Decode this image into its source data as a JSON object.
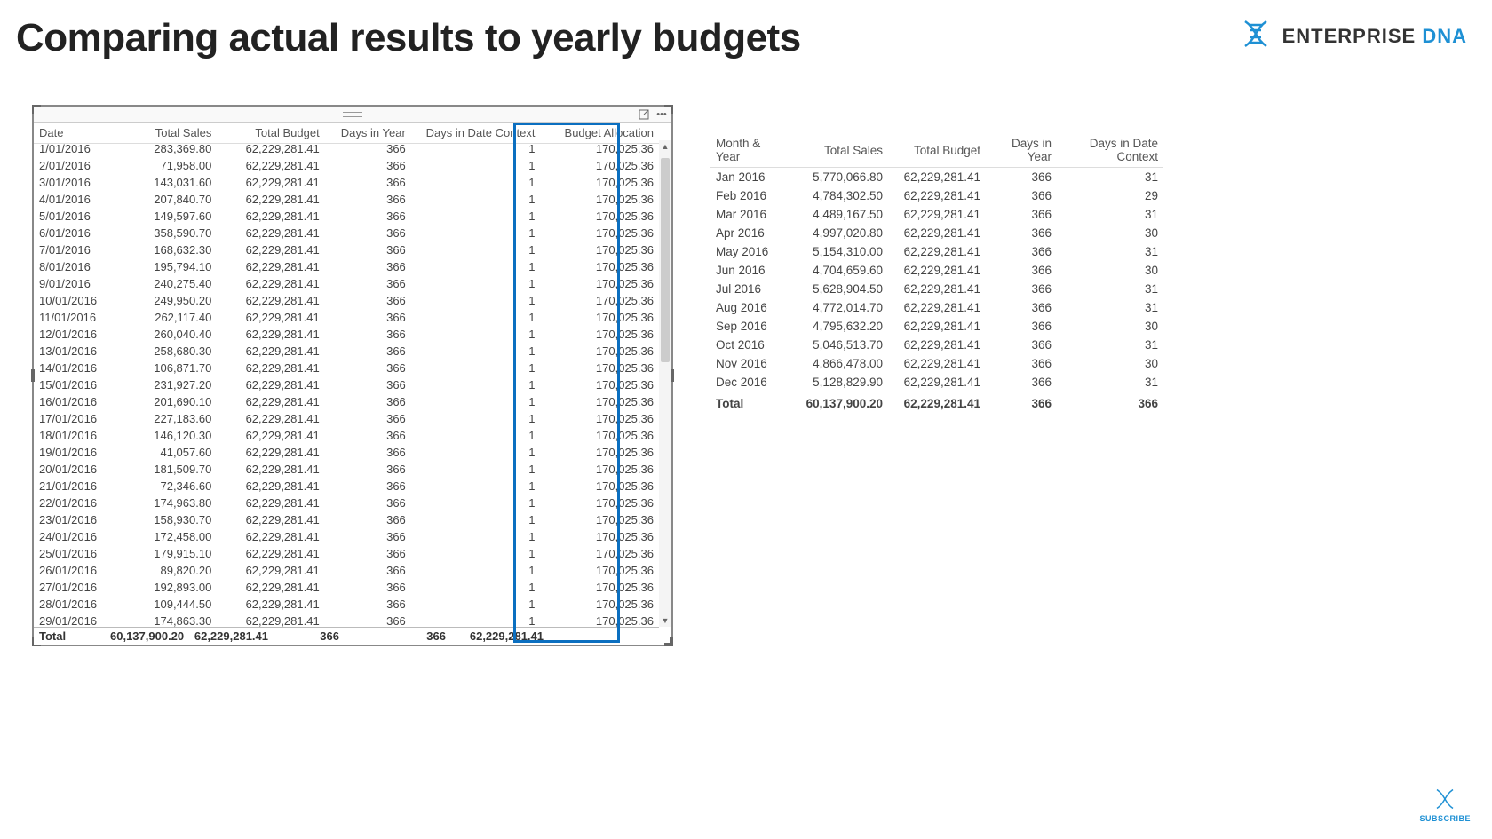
{
  "page_title": "Comparing actual results to yearly budgets",
  "brand": {
    "text1": "ENTERPRISE ",
    "text2": "DNA"
  },
  "subscribe_label": "SUBSCRIBE",
  "daily_table": {
    "headers": {
      "date": "Date",
      "total_sales": "Total Sales",
      "total_budget": "Total Budget",
      "days_in_year": "Days in Year",
      "days_in_context": "Days in Date Context",
      "budget_allocation": "Budget Allocation"
    },
    "rows": [
      {
        "date": "1/01/2016",
        "sales": "283,369.80",
        "budget": "62,229,281.41",
        "diy": "366",
        "ctx": "1",
        "alloc": "170,025.36"
      },
      {
        "date": "2/01/2016",
        "sales": "71,958.00",
        "budget": "62,229,281.41",
        "diy": "366",
        "ctx": "1",
        "alloc": "170,025.36"
      },
      {
        "date": "3/01/2016",
        "sales": "143,031.60",
        "budget": "62,229,281.41",
        "diy": "366",
        "ctx": "1",
        "alloc": "170,025.36"
      },
      {
        "date": "4/01/2016",
        "sales": "207,840.70",
        "budget": "62,229,281.41",
        "diy": "366",
        "ctx": "1",
        "alloc": "170,025.36"
      },
      {
        "date": "5/01/2016",
        "sales": "149,597.60",
        "budget": "62,229,281.41",
        "diy": "366",
        "ctx": "1",
        "alloc": "170,025.36"
      },
      {
        "date": "6/01/2016",
        "sales": "358,590.70",
        "budget": "62,229,281.41",
        "diy": "366",
        "ctx": "1",
        "alloc": "170,025.36"
      },
      {
        "date": "7/01/2016",
        "sales": "168,632.30",
        "budget": "62,229,281.41",
        "diy": "366",
        "ctx": "1",
        "alloc": "170,025.36"
      },
      {
        "date": "8/01/2016",
        "sales": "195,794.10",
        "budget": "62,229,281.41",
        "diy": "366",
        "ctx": "1",
        "alloc": "170,025.36"
      },
      {
        "date": "9/01/2016",
        "sales": "240,275.40",
        "budget": "62,229,281.41",
        "diy": "366",
        "ctx": "1",
        "alloc": "170,025.36"
      },
      {
        "date": "10/01/2016",
        "sales": "249,950.20",
        "budget": "62,229,281.41",
        "diy": "366",
        "ctx": "1",
        "alloc": "170,025.36"
      },
      {
        "date": "11/01/2016",
        "sales": "262,117.40",
        "budget": "62,229,281.41",
        "diy": "366",
        "ctx": "1",
        "alloc": "170,025.36"
      },
      {
        "date": "12/01/2016",
        "sales": "260,040.40",
        "budget": "62,229,281.41",
        "diy": "366",
        "ctx": "1",
        "alloc": "170,025.36"
      },
      {
        "date": "13/01/2016",
        "sales": "258,680.30",
        "budget": "62,229,281.41",
        "diy": "366",
        "ctx": "1",
        "alloc": "170,025.36"
      },
      {
        "date": "14/01/2016",
        "sales": "106,871.70",
        "budget": "62,229,281.41",
        "diy": "366",
        "ctx": "1",
        "alloc": "170,025.36"
      },
      {
        "date": "15/01/2016",
        "sales": "231,927.20",
        "budget": "62,229,281.41",
        "diy": "366",
        "ctx": "1",
        "alloc": "170,025.36"
      },
      {
        "date": "16/01/2016",
        "sales": "201,690.10",
        "budget": "62,229,281.41",
        "diy": "366",
        "ctx": "1",
        "alloc": "170,025.36"
      },
      {
        "date": "17/01/2016",
        "sales": "227,183.60",
        "budget": "62,229,281.41",
        "diy": "366",
        "ctx": "1",
        "alloc": "170,025.36"
      },
      {
        "date": "18/01/2016",
        "sales": "146,120.30",
        "budget": "62,229,281.41",
        "diy": "366",
        "ctx": "1",
        "alloc": "170,025.36"
      },
      {
        "date": "19/01/2016",
        "sales": "41,057.60",
        "budget": "62,229,281.41",
        "diy": "366",
        "ctx": "1",
        "alloc": "170,025.36"
      },
      {
        "date": "20/01/2016",
        "sales": "181,509.70",
        "budget": "62,229,281.41",
        "diy": "366",
        "ctx": "1",
        "alloc": "170,025.36"
      },
      {
        "date": "21/01/2016",
        "sales": "72,346.60",
        "budget": "62,229,281.41",
        "diy": "366",
        "ctx": "1",
        "alloc": "170,025.36"
      },
      {
        "date": "22/01/2016",
        "sales": "174,963.80",
        "budget": "62,229,281.41",
        "diy": "366",
        "ctx": "1",
        "alloc": "170,025.36"
      },
      {
        "date": "23/01/2016",
        "sales": "158,930.70",
        "budget": "62,229,281.41",
        "diy": "366",
        "ctx": "1",
        "alloc": "170,025.36"
      },
      {
        "date": "24/01/2016",
        "sales": "172,458.00",
        "budget": "62,229,281.41",
        "diy": "366",
        "ctx": "1",
        "alloc": "170,025.36"
      },
      {
        "date": "25/01/2016",
        "sales": "179,915.10",
        "budget": "62,229,281.41",
        "diy": "366",
        "ctx": "1",
        "alloc": "170,025.36"
      },
      {
        "date": "26/01/2016",
        "sales": "89,820.20",
        "budget": "62,229,281.41",
        "diy": "366",
        "ctx": "1",
        "alloc": "170,025.36"
      },
      {
        "date": "27/01/2016",
        "sales": "192,893.00",
        "budget": "62,229,281.41",
        "diy": "366",
        "ctx": "1",
        "alloc": "170,025.36"
      },
      {
        "date": "28/01/2016",
        "sales": "109,444.50",
        "budget": "62,229,281.41",
        "diy": "366",
        "ctx": "1",
        "alloc": "170,025.36"
      },
      {
        "date": "29/01/2016",
        "sales": "174,863.30",
        "budget": "62,229,281.41",
        "diy": "366",
        "ctx": "1",
        "alloc": "170,025.36"
      }
    ],
    "total": {
      "label": "Total",
      "sales": "60,137,900.20",
      "budget": "62,229,281.41",
      "diy": "366",
      "ctx": "366",
      "alloc": "62,229,281.41"
    }
  },
  "monthly_table": {
    "headers": {
      "month": "Month & Year",
      "total_sales": "Total Sales",
      "total_budget": "Total Budget",
      "days_in_year": "Days in Year",
      "days_in_context": "Days in Date Context"
    },
    "rows": [
      {
        "month": "Jan 2016",
        "sales": "5,770,066.80",
        "budget": "62,229,281.41",
        "diy": "366",
        "ctx": "31"
      },
      {
        "month": "Feb 2016",
        "sales": "4,784,302.50",
        "budget": "62,229,281.41",
        "diy": "366",
        "ctx": "29"
      },
      {
        "month": "Mar 2016",
        "sales": "4,489,167.50",
        "budget": "62,229,281.41",
        "diy": "366",
        "ctx": "31"
      },
      {
        "month": "Apr 2016",
        "sales": "4,997,020.80",
        "budget": "62,229,281.41",
        "diy": "366",
        "ctx": "30"
      },
      {
        "month": "May 2016",
        "sales": "5,154,310.00",
        "budget": "62,229,281.41",
        "diy": "366",
        "ctx": "31"
      },
      {
        "month": "Jun 2016",
        "sales": "4,704,659.60",
        "budget": "62,229,281.41",
        "diy": "366",
        "ctx": "30"
      },
      {
        "month": "Jul 2016",
        "sales": "5,628,904.50",
        "budget": "62,229,281.41",
        "diy": "366",
        "ctx": "31"
      },
      {
        "month": "Aug 2016",
        "sales": "4,772,014.70",
        "budget": "62,229,281.41",
        "diy": "366",
        "ctx": "31"
      },
      {
        "month": "Sep 2016",
        "sales": "4,795,632.20",
        "budget": "62,229,281.41",
        "diy": "366",
        "ctx": "30"
      },
      {
        "month": "Oct 2016",
        "sales": "5,046,513.70",
        "budget": "62,229,281.41",
        "diy": "366",
        "ctx": "31"
      },
      {
        "month": "Nov 2016",
        "sales": "4,866,478.00",
        "budget": "62,229,281.41",
        "diy": "366",
        "ctx": "30"
      },
      {
        "month": "Dec 2016",
        "sales": "5,128,829.90",
        "budget": "62,229,281.41",
        "diy": "366",
        "ctx": "31"
      }
    ],
    "total": {
      "label": "Total",
      "sales": "60,137,900.20",
      "budget": "62,229,281.41",
      "diy": "366",
      "ctx": "366"
    }
  }
}
